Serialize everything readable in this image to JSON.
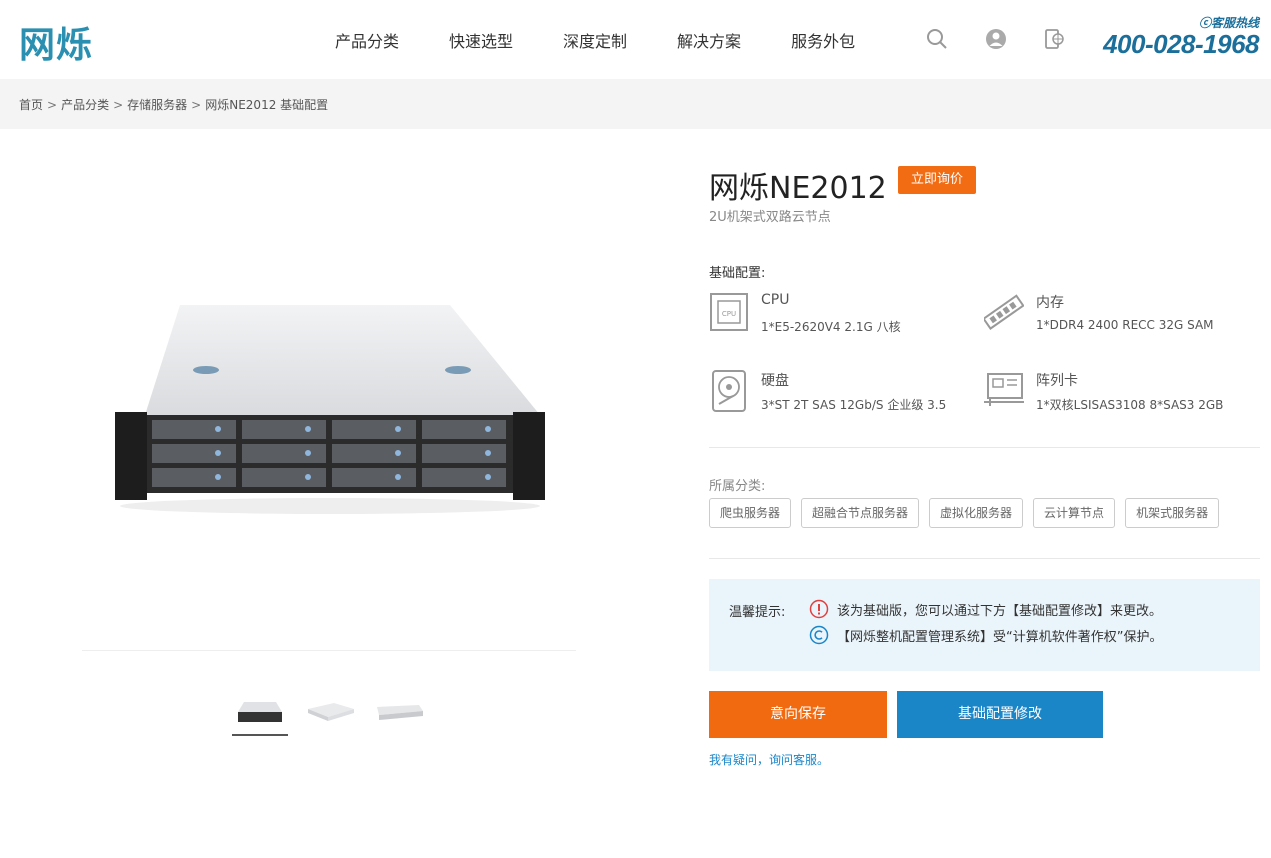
{
  "header": {
    "logo_text": "网烁",
    "nav": [
      "产品分类",
      "快速选型",
      "深度定制",
      "解决方案",
      "服务外包"
    ],
    "hotline_label": "ⓒ客服热线",
    "hotline_number": "400-028-1968"
  },
  "breadcrumb": {
    "items": [
      "首页",
      "产品分类",
      "存储服务器",
      "网烁NE2012 基础配置"
    ],
    "separator": ">"
  },
  "product": {
    "title": "网烁NE2012",
    "ask_button": "立即询价",
    "subtitle": "2U机架式双路云节点",
    "config_heading": "基础配置:",
    "specs": [
      {
        "name": "CPU",
        "value": "1*E5-2620V4 2.1G 八核",
        "icon": "cpu-icon"
      },
      {
        "name": "内存",
        "value": "1*DDR4 2400 RECC 32G SAM",
        "icon": "memory-icon"
      },
      {
        "name": "硬盘",
        "value": "3*ST 2T SAS 12Gb/S 企业级 3.5",
        "icon": "hard-disk-icon"
      },
      {
        "name": "阵列卡",
        "value": "1*双核LSISAS3108 8*SAS3 2GB",
        "icon": "raid-card-icon"
      }
    ],
    "category_label": "所属分类:",
    "tags": [
      "爬虫服务器",
      "超融合节点服务器",
      "虚拟化服务器",
      "云计算节点",
      "机架式服务器"
    ]
  },
  "tips": {
    "label": "温馨提示:",
    "line1": "该为基础版，您可以通过下方【基础配置修改】来更改。",
    "line2": "【网烁整机配置管理系统】受“计算机软件著作权”保护。"
  },
  "actions": {
    "save": "意向保存",
    "modify": "基础配置修改",
    "help": "我有疑问，询问客服。"
  },
  "colors": {
    "brand": "#2a8fb0",
    "orange": "#f26a0f",
    "blue": "#1a86c8"
  }
}
